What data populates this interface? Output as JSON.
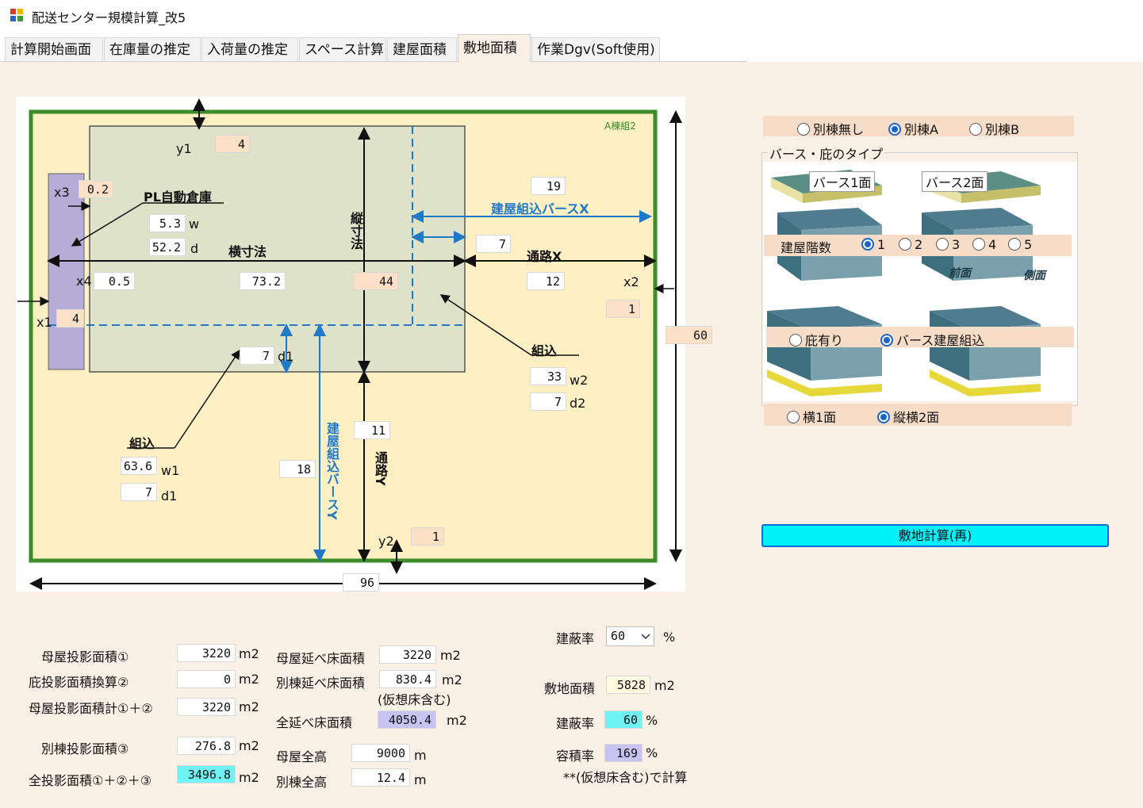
{
  "window": {
    "title": "配送センター規模計算_改5"
  },
  "tabs": [
    "計算開始画面",
    "在庫量の推定",
    "入荷量の推定",
    "スペース計算",
    "建屋面積",
    "敷地面積",
    "作業Dgv(Soft使用)"
  ],
  "diagram": {
    "corner_label": "A棟組2",
    "labels": {
      "pl": "PL自動倉庫",
      "yoko": "横寸法",
      "tate": "縦寸法",
      "tsuro_x": "通路X",
      "tsuro_y": "通路Y",
      "berth_x": "建屋組込バースX",
      "berth_y": "建屋組込バースY",
      "kumikomi1": "組込",
      "kumikomi2": "組込",
      "y1": "y1",
      "y2": "y2",
      "x1": "x1",
      "x2": "x2",
      "x3": "x3",
      "x4": "x4",
      "w": "w",
      "d": "d",
      "d1": "d1",
      "d1b": "d1",
      "w1": "w1",
      "w2": "w2",
      "d2": "d2"
    },
    "values": {
      "y1": "4",
      "x3": "0.2",
      "w": "5.3",
      "d": "52.2",
      "x4": "0.5",
      "yoko": "73.2",
      "tate": "44",
      "berth_x": "19",
      "berth_x_depth": "7",
      "tsuro_x": "12",
      "x2": "1",
      "x1": "4",
      "d1": "7",
      "height": "60",
      "w2": "33",
      "d2": "7",
      "tsuro_y": "11",
      "w1": "63.6",
      "d1b": "7",
      "berth_y": "18",
      "y2": "1",
      "width": "96"
    }
  },
  "right_panel": {
    "annex": {
      "options": [
        "別棟無し",
        "別棟A",
        "別棟B"
      ],
      "selected": "別棟A"
    },
    "group_title": "バース・庇のタイプ",
    "img_label1": "バース1面",
    "img_label2": "バース2面",
    "floors": {
      "label": "建屋階数",
      "options": [
        "1",
        "2",
        "3",
        "4",
        "5"
      ],
      "selected": "1"
    },
    "front_label": "前面",
    "side_label": "側面",
    "type": {
      "options": [
        "庇有り",
        "バース建屋組込"
      ],
      "selected": "バース建屋組込"
    },
    "sides": {
      "options": [
        "横1面",
        "縦横2面"
      ],
      "selected": "縦横2面"
    },
    "calc_button": "敷地計算(再)"
  },
  "bottom": {
    "col1": [
      {
        "label": "母屋投影面積①",
        "value": "3220",
        "unit": "m2"
      },
      {
        "label": "庇投影面積換算②",
        "value": "0",
        "unit": "m2"
      },
      {
        "label": "母屋投影面積計①＋②",
        "value": "3220",
        "unit": "m2"
      },
      {
        "label": "別棟投影面積③",
        "value": "276.8",
        "unit": "m2"
      },
      {
        "label": "全投影面積①＋②＋③",
        "value": "3496.8",
        "unit": "m2"
      }
    ],
    "col2": [
      {
        "label": "母屋延べ床面積",
        "value": "3220",
        "unit": "m2"
      },
      {
        "label": "別棟延べ床面積",
        "value": "830.4",
        "unit": "m2"
      },
      {
        "label": "全延べ床面積",
        "value": "4050.4",
        "unit": "m2"
      },
      {
        "label": "母屋全高",
        "value": "9000",
        "unit": "m"
      },
      {
        "label": "別棟全高",
        "value": "12.4",
        "unit": "m"
      }
    ],
    "virtual_note": "(仮想床含む)",
    "col3": {
      "kenpei_label": "建蔽率",
      "kenpei_select": "60",
      "kenpei_unit": "%",
      "site_label": "敷地面積",
      "site_value": "5828",
      "site_unit": "m2",
      "kenpei2_label": "建蔽率",
      "kenpei2_value": "60",
      "kenpei2_unit": "%",
      "yoseki_label": "容積率",
      "yoseki_value": "169",
      "yoseki_unit": "%",
      "note": "**(仮想床含む)で計算"
    }
  },
  "colors": {
    "outer_green": "#3c8c2a",
    "site_fill": "#fff0c4",
    "building_fill": "#dde2c8",
    "lavender": "#b6acd8",
    "accent_blue": "#1f79c8",
    "cyan": "#00f2f8"
  }
}
